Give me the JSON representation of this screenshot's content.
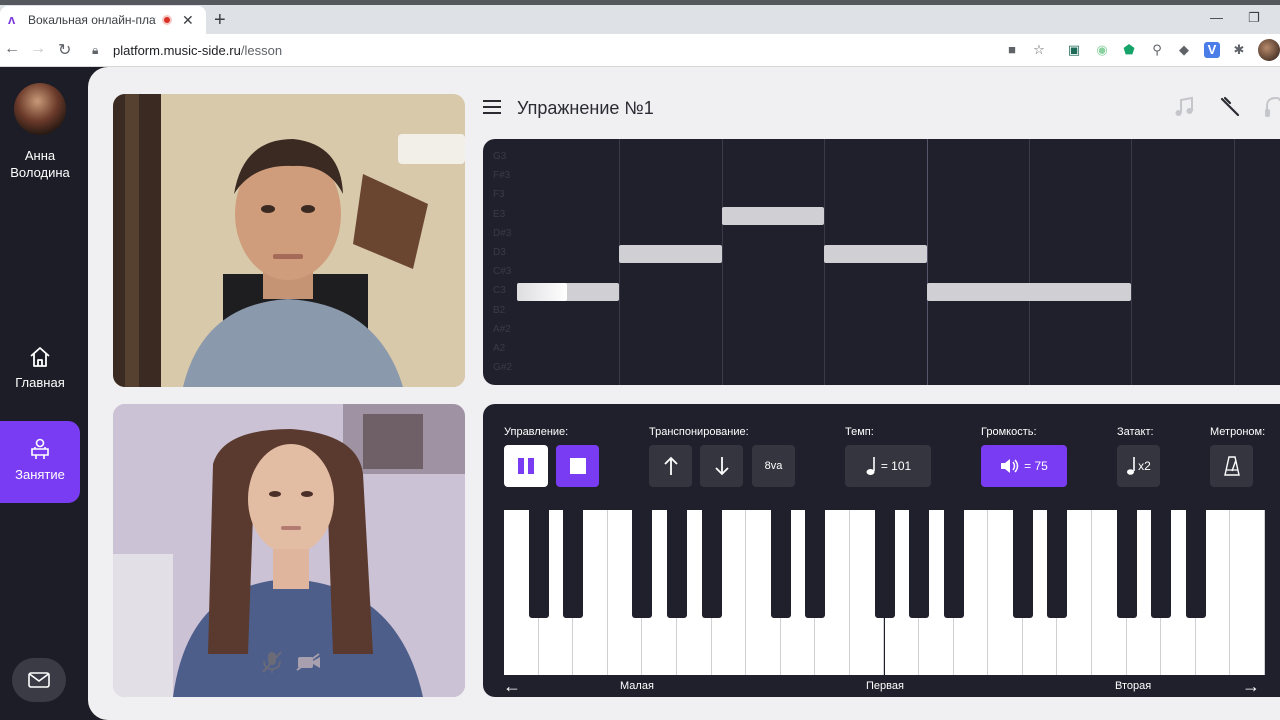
{
  "browser": {
    "tab_title": "Вокальная онлайн-платфор",
    "url_host": "platform.music-side.ru",
    "url_path": "/lesson",
    "new_tab": "+",
    "close_tab": "✕",
    "back": "←",
    "forward": "→",
    "reload": "↻"
  },
  "sidebar": {
    "user_name_line1": "Анна",
    "user_name_line2": "Володина",
    "home_label": "Главная",
    "lesson_label": "Занятие"
  },
  "exercise": {
    "title": "Упражнение №1"
  },
  "piano_roll": {
    "note_labels": [
      "G3",
      "F#3",
      "F3",
      "E3",
      "D#3",
      "D3",
      "C#3",
      "C3",
      "B2",
      "A#2",
      "A2",
      "G#2"
    ],
    "notes": [
      {
        "pitch": "C3",
        "start": 0,
        "length": 1
      },
      {
        "pitch": "D3",
        "start": 1,
        "length": 1
      },
      {
        "pitch": "E3",
        "start": 2,
        "length": 1
      },
      {
        "pitch": "D3",
        "start": 3,
        "length": 1
      },
      {
        "pitch": "C3",
        "start": 4,
        "length": 2
      }
    ]
  },
  "controls": {
    "control_label": "Управление:",
    "transpose_label": "Транспонирование:",
    "tempo_label": "Темп:",
    "volume_label": "Громкость:",
    "count_in_label": "Затакт:",
    "metronome_label": "Метроном:",
    "tempo_value": "= 101",
    "volume_value": "= 75",
    "count_in_value": "x2",
    "octave_value": "8va"
  },
  "keyboard": {
    "octave_small": "Малая",
    "octave_first": "Первая",
    "octave_second": "Вторая",
    "prev_arrow": "←",
    "next_arrow": "→"
  },
  "colors": {
    "accent": "#7a3cf2",
    "sidebar_bg": "#1d1d27",
    "panel_bg": "#20202c"
  }
}
